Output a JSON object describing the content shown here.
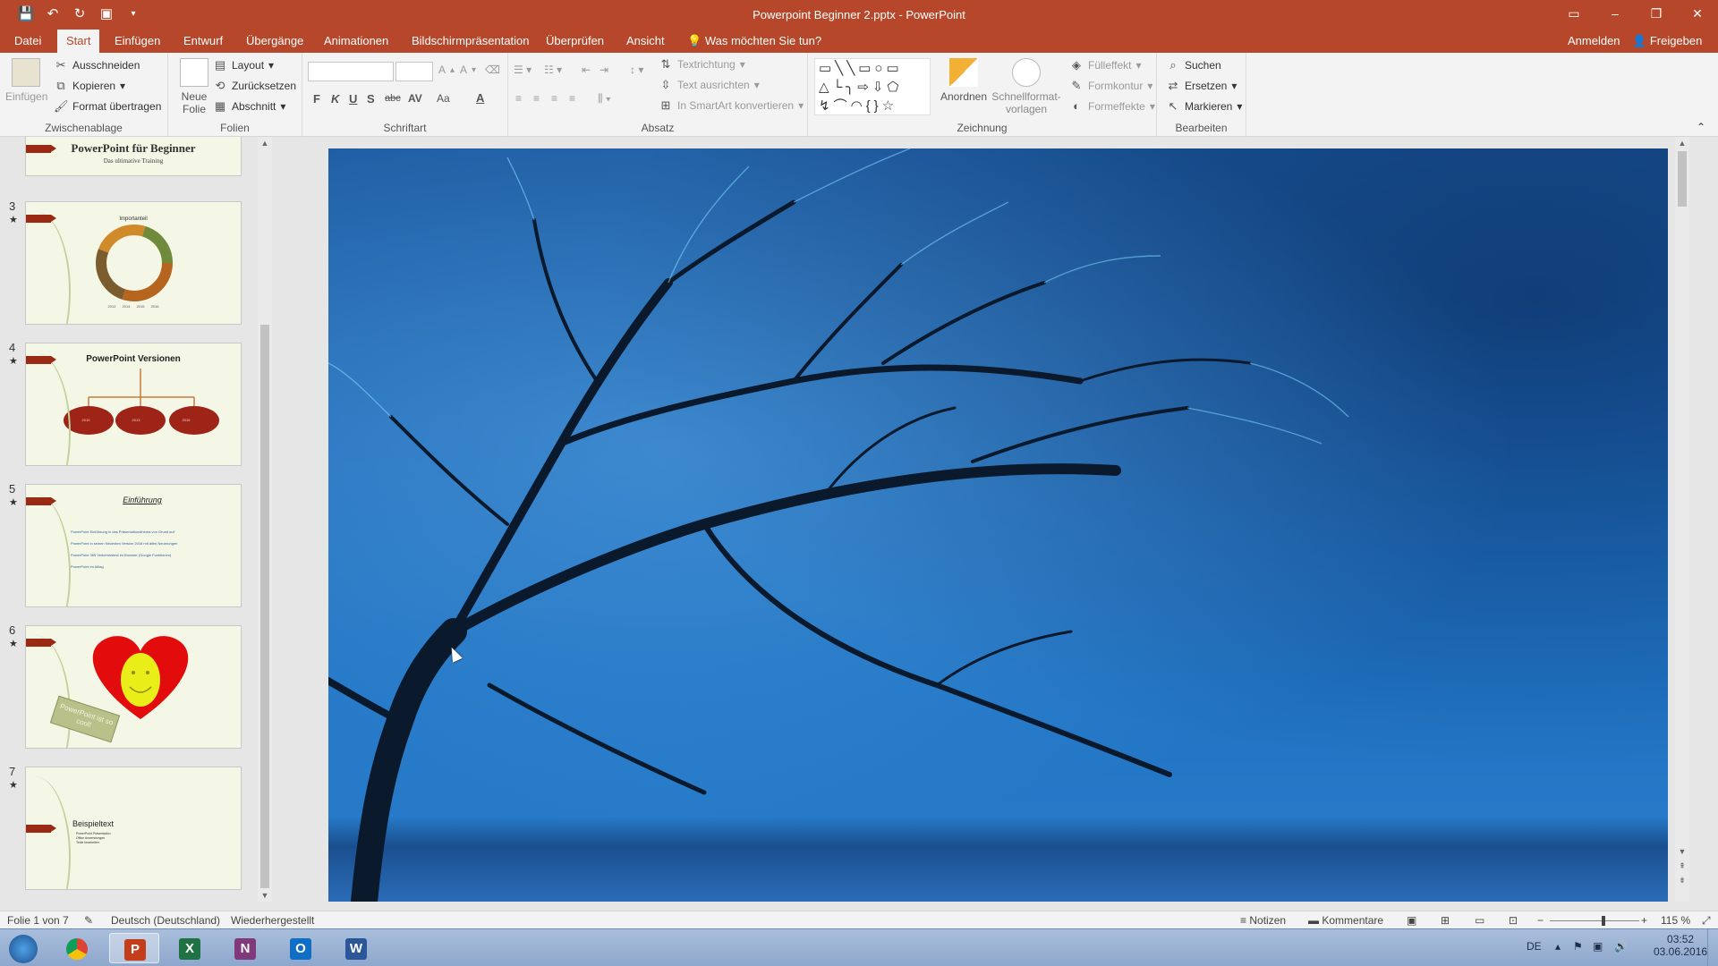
{
  "window": {
    "title": "Powerpoint Beginner 2.pptx - PowerPoint",
    "accent": "#b7472a"
  },
  "quick_access": [
    "save-icon",
    "undo-icon",
    "redo-icon",
    "present-icon",
    "customize-icon"
  ],
  "tabs": [
    {
      "label": "Datei"
    },
    {
      "label": "Start"
    },
    {
      "label": "Einfügen"
    },
    {
      "label": "Entwurf"
    },
    {
      "label": "Übergänge"
    },
    {
      "label": "Animationen"
    },
    {
      "label": "Bildschirmpräsentation"
    },
    {
      "label": "Überprüfen"
    },
    {
      "label": "Ansicht"
    }
  ],
  "active_tab": "Start",
  "tell_me": "Was möchten Sie tun?",
  "account": {
    "signin": "Anmelden",
    "share": "Freigeben"
  },
  "ribbon": {
    "clipboard": {
      "label": "Zwischenablage",
      "paste": "Einfügen",
      "cut": "Ausschneiden",
      "copy": "Kopieren",
      "format_painter": "Format übertragen"
    },
    "slides": {
      "label": "Folien",
      "new_slide_line1": "Neue",
      "new_slide_line2": "Folie",
      "layout": "Layout",
      "reset": "Zurücksetzen",
      "section": "Abschnitt"
    },
    "font": {
      "label": "Schriftart",
      "bold": "F",
      "italic": "K",
      "underline": "U",
      "shadow": "S",
      "strike": "abc",
      "spacing": "AV",
      "case": "Aa",
      "color": "A"
    },
    "paragraph": {
      "label": "Absatz",
      "text_direction": "Textrichtung",
      "align_text": "Text ausrichten",
      "smartart": "In SmartArt konvertieren"
    },
    "drawing": {
      "label": "Zeichnung",
      "arrange": "Anordnen",
      "quick_styles_line1": "Schnellformat-",
      "quick_styles_line2": "vorlagen",
      "fill": "Fülleffekt",
      "outline": "Formkontur",
      "effects": "Formeffekte"
    },
    "editing": {
      "label": "Bearbeiten",
      "find": "Suchen",
      "replace": "Ersetzen",
      "select": "Markieren"
    }
  },
  "thumbnails": [
    {
      "number": "",
      "star": "",
      "title": "PowerPoint für Beginner",
      "subtitle": "Das ultimative Training"
    },
    {
      "number": "3",
      "star": "★",
      "title": "Importanteil",
      "labels": [
        "2013",
        "2014",
        "2015",
        "2016"
      ]
    },
    {
      "number": "4",
      "star": "★",
      "title": "PowerPoint Versionen",
      "labels": [
        "2010",
        "2013",
        "2016"
      ]
    },
    {
      "number": "5",
      "star": "★",
      "title": "Einführung",
      "bullets": [
        "PowerPoint Einführung in das Präsentationsthema von Grund auf",
        "PowerPoint in seinen Neuesten Version 2016 mit allen Neuerungen",
        "PowerPoint 365 Verkehrsstest im Browser (Google Funktionen)",
        "PowerPoint im Alltag"
      ]
    },
    {
      "number": "6",
      "star": "★",
      "sticker": "PowerPoint ist so cool!"
    },
    {
      "number": "7",
      "star": "★",
      "title": "Beispieltext",
      "bullets": [
        "PowerPoint Präsentation",
        "Office Anwendungen",
        "Texte bearbeiten"
      ]
    }
  ],
  "statusbar": {
    "slide_info": "Folie 1 von 7",
    "language": "Deutsch (Deutschland)",
    "recovered": "Wiederhergestellt",
    "notes": "Notizen",
    "comments": "Kommentare",
    "zoom": "115 %",
    "zoom_level": 0.6
  },
  "taskbar": {
    "apps": [
      {
        "name": "Windows Start",
        "icon": "windows-start-icon"
      },
      {
        "name": "Chrome",
        "icon": "chrome-icon"
      },
      {
        "name": "PowerPoint",
        "icon": "powerpoint-icon",
        "letter": "P",
        "color": "#c43e1c"
      },
      {
        "name": "Excel",
        "icon": "excel-icon",
        "letter": "X",
        "color": "#1f7244"
      },
      {
        "name": "OneNote",
        "icon": "onenote-icon",
        "letter": "N",
        "color": "#80397b"
      },
      {
        "name": "Outlook",
        "icon": "outlook-icon",
        "letter": "O",
        "color": "#0f6fc6"
      },
      {
        "name": "Word",
        "icon": "word-icon",
        "letter": "W",
        "color": "#2b579a"
      }
    ],
    "lang": "DE",
    "time": "03:52",
    "date": "03.06.2016"
  }
}
